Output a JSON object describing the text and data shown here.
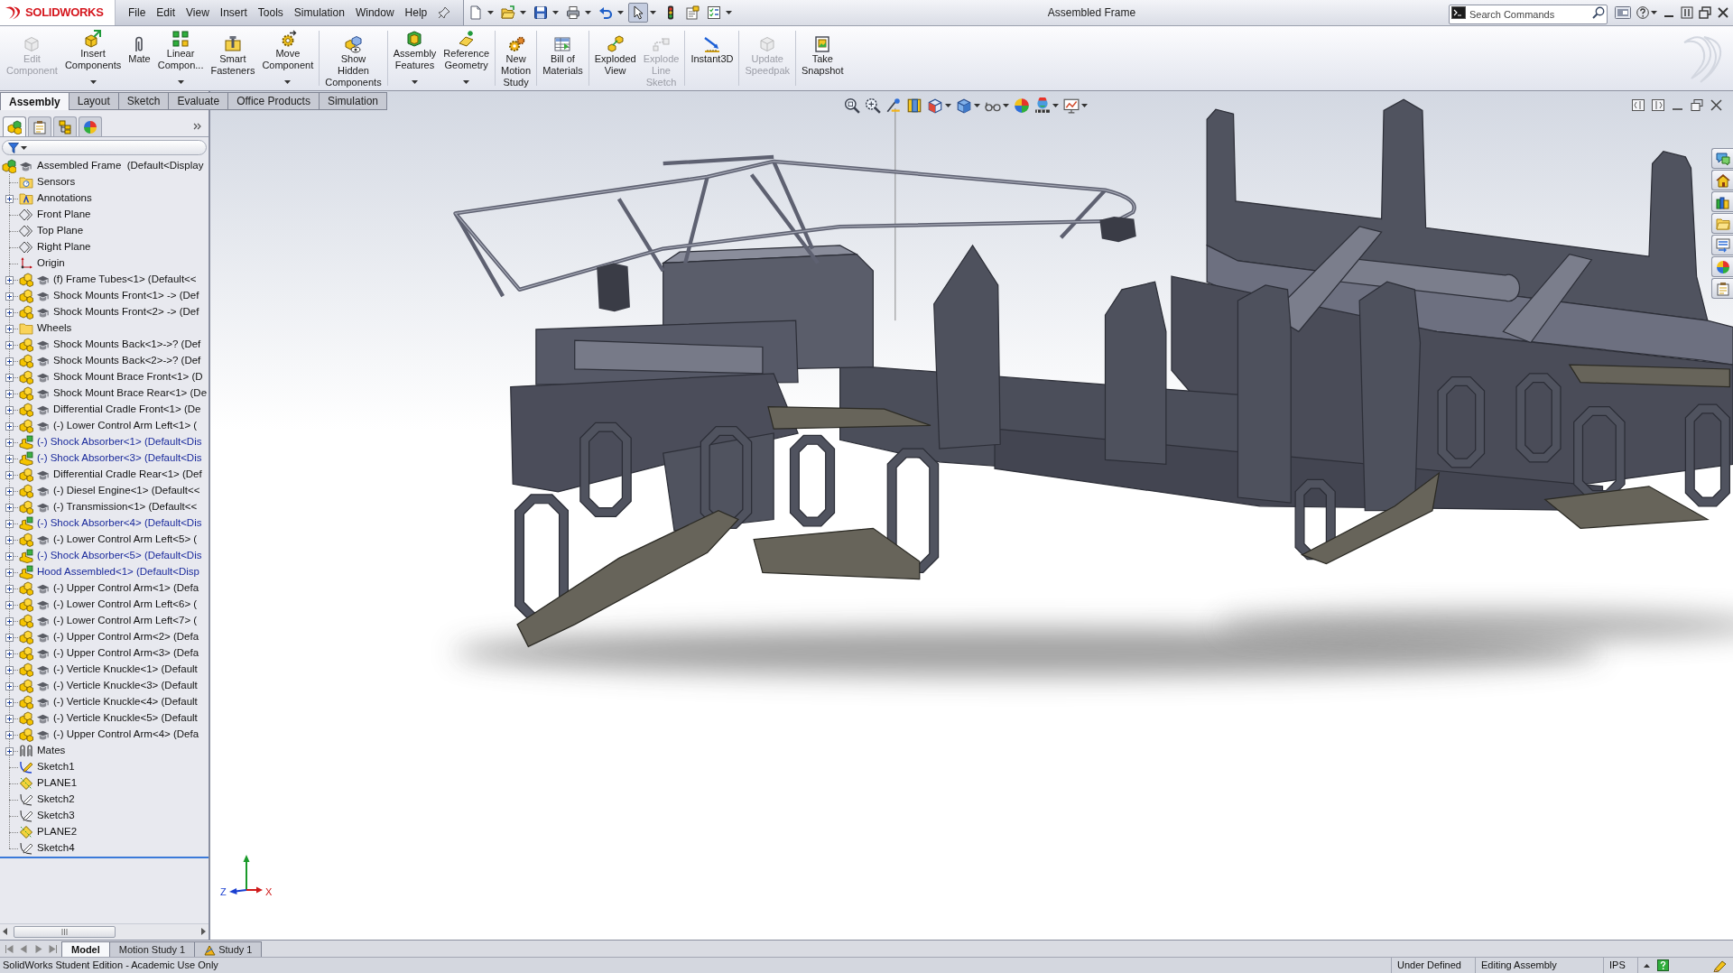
{
  "app": {
    "logo_text": "SOLIDWORKS"
  },
  "menu": [
    "File",
    "Edit",
    "View",
    "Insert",
    "Tools",
    "Simulation",
    "Window",
    "Help"
  ],
  "quick_access": [
    {
      "kind": "new",
      "dropdown": true,
      "pressed": false
    },
    {
      "kind": "open",
      "dropdown": true,
      "pressed": false
    },
    {
      "kind": "save",
      "dropdown": true,
      "pressed": false
    },
    {
      "kind": "print",
      "dropdown": true,
      "pressed": false
    },
    {
      "kind": "undo",
      "dropdown": true,
      "pressed": false
    },
    {
      "kind": "select",
      "dropdown": true,
      "pressed": true
    },
    {
      "kind": "rebuild",
      "dropdown": false,
      "pressed": false
    },
    {
      "kind": "properties",
      "dropdown": false,
      "pressed": false
    },
    {
      "kind": "options",
      "dropdown": true,
      "pressed": false
    }
  ],
  "window": {
    "title": "Assembled Frame"
  },
  "search": {
    "placeholder": "Search Commands"
  },
  "ribbon": {
    "groups": [
      {
        "buttons": [
          {
            "kind": "edit",
            "label": "Edit\nComponent",
            "disabled": true,
            "dropdown": false
          },
          {
            "kind": "insert",
            "label": "Insert\nComponents",
            "disabled": false,
            "dropdown": true
          },
          {
            "kind": "mate",
            "label": "Mate",
            "disabled": false,
            "dropdown": false
          },
          {
            "kind": "pattern",
            "label": "Linear\nCompon...",
            "disabled": false,
            "dropdown": true
          },
          {
            "kind": "fastener",
            "label": "Smart\nFasteners",
            "disabled": false,
            "dropdown": false
          },
          {
            "kind": "move",
            "label": "Move\nComponent",
            "disabled": false,
            "dropdown": true
          }
        ]
      },
      {
        "buttons": [
          {
            "kind": "show",
            "label": "Show\nHidden\nComponents",
            "disabled": false,
            "dropdown": false
          }
        ]
      },
      {
        "buttons": [
          {
            "kind": "features",
            "label": "Assembly\nFeatures",
            "disabled": false,
            "dropdown": true
          },
          {
            "kind": "geometry",
            "label": "Reference\nGeometry",
            "disabled": false,
            "dropdown": true
          }
        ]
      },
      {
        "buttons": [
          {
            "kind": "motion",
            "label": "New\nMotion\nStudy",
            "disabled": false,
            "dropdown": false
          }
        ]
      },
      {
        "buttons": [
          {
            "kind": "bom",
            "label": "Bill of\nMaterials",
            "disabled": false,
            "dropdown": false
          }
        ]
      },
      {
        "buttons": [
          {
            "kind": "explode",
            "label": "Exploded\nView",
            "disabled": false,
            "dropdown": false
          },
          {
            "kind": "explodeline",
            "label": "Explode\nLine\nSketch",
            "disabled": true,
            "dropdown": false
          }
        ]
      },
      {
        "buttons": [
          {
            "kind": "instant3d",
            "label": "Instant3D",
            "disabled": false,
            "dropdown": false
          }
        ]
      },
      {
        "buttons": [
          {
            "kind": "speedpak",
            "label": "Update\nSpeedpak",
            "disabled": true,
            "dropdown": false
          }
        ]
      },
      {
        "buttons": [
          {
            "kind": "snapshot",
            "label": "Take\nSnapshot",
            "disabled": false,
            "dropdown": false
          }
        ]
      }
    ]
  },
  "command_tabs": [
    {
      "label": "Assembly",
      "selected": true
    },
    {
      "label": "Layout",
      "selected": false
    },
    {
      "label": "Sketch",
      "selected": false
    },
    {
      "label": "Evaluate",
      "selected": false
    },
    {
      "label": "Office Products",
      "selected": false
    },
    {
      "label": "Simulation",
      "selected": false
    }
  ],
  "panel_tabs": [
    {
      "kind": "feature",
      "selected": true
    },
    {
      "kind": "property",
      "selected": false
    },
    {
      "kind": "configuration",
      "selected": false
    },
    {
      "kind": "display",
      "selected": false
    }
  ],
  "feature_tree": {
    "label": "Assembled Frame  (Default<Display",
    "kind": "assembly",
    "children": [
      {
        "label": "Sensors",
        "kind": "sensors",
        "expandable": false
      },
      {
        "label": "Annotations",
        "kind": "annotations",
        "expandable": true
      },
      {
        "label": "Front Plane",
        "kind": "plane",
        "expandable": false
      },
      {
        "label": "Top Plane",
        "kind": "plane",
        "expandable": false
      },
      {
        "label": "Right Plane",
        "kind": "plane",
        "expandable": false
      },
      {
        "label": "Origin",
        "kind": "origin",
        "expandable": false
      },
      {
        "label": "(f) Frame Tubes<1> (Default<<",
        "kind": "part",
        "expandable": true
      },
      {
        "label": "Shock Mounts Front<1> -> (Def",
        "kind": "part",
        "expandable": true
      },
      {
        "label": "Shock Mounts Front<2> -> (Def",
        "kind": "part",
        "expandable": true
      },
      {
        "label": "Wheels",
        "kind": "folder",
        "expandable": true
      },
      {
        "label": "Shock Mounts Back<1>->? (Def",
        "kind": "part",
        "expandable": true
      },
      {
        "label": "Shock Mounts Back<2>->? (Def",
        "kind": "part",
        "expandable": true
      },
      {
        "label": "Shock Mount Brace Front<1> (D",
        "kind": "part",
        "expandable": true
      },
      {
        "label": "Shock Mount Brace Rear<1> (De",
        "kind": "part",
        "expandable": true
      },
      {
        "label": "Differential Cradle Front<1> (De",
        "kind": "part",
        "expandable": true
      },
      {
        "label": "(-) Lower Control Arm Left<1> (",
        "kind": "part",
        "expandable": true
      },
      {
        "label": "(-) Shock Absorber<1> (Default<Dis",
        "kind": "subassembly",
        "expandable": true
      },
      {
        "label": "(-) Shock Absorber<3> (Default<Dis",
        "kind": "subassembly",
        "expandable": true
      },
      {
        "label": "Differential Cradle Rear<1> (Def",
        "kind": "part",
        "expandable": true
      },
      {
        "label": "(-) Diesel Engine<1> (Default<<",
        "kind": "part",
        "expandable": true
      },
      {
        "label": "(-) Transmission<1> (Default<<",
        "kind": "part",
        "expandable": true
      },
      {
        "label": "(-) Shock Absorber<4> (Default<Dis",
        "kind": "subassembly",
        "expandable": true
      },
      {
        "label": "(-) Lower Control Arm Left<5> (",
        "kind": "part",
        "expandable": true
      },
      {
        "label": "(-) Shock Absorber<5> (Default<Dis",
        "kind": "subassembly",
        "expandable": true
      },
      {
        "label": "Hood Assembled<1> (Default<Disp",
        "kind": "subassembly",
        "expandable": true
      },
      {
        "label": "(-) Upper Control Arm<1> (Defa",
        "kind": "part",
        "expandable": true
      },
      {
        "label": "(-) Lower Control Arm Left<6> (",
        "kind": "part",
        "expandable": true
      },
      {
        "label": "(-) Lower Control Arm Left<7> (",
        "kind": "part",
        "expandable": true
      },
      {
        "label": "(-) Upper Control Arm<2> (Defa",
        "kind": "part",
        "expandable": true
      },
      {
        "label": "(-) Upper Control Arm<3> (Defa",
        "kind": "part",
        "expandable": true
      },
      {
        "label": "(-) Verticle Knuckle<1> (Default",
        "kind": "part",
        "expandable": true
      },
      {
        "label": "(-) Verticle Knuckle<3> (Default",
        "kind": "part",
        "expandable": true
      },
      {
        "label": "(-) Verticle Knuckle<4> (Default",
        "kind": "part",
        "expandable": true
      },
      {
        "label": "(-) Verticle Knuckle<5> (Default",
        "kind": "part",
        "expandable": true
      },
      {
        "label": "(-) Upper Control Arm<4> (Defa",
        "kind": "part",
        "expandable": true
      },
      {
        "label": "Mates",
        "kind": "mates",
        "expandable": true
      },
      {
        "label": "Sketch1",
        "kind": "activesketch",
        "expandable": false
      },
      {
        "label": "PLANE1",
        "kind": "refplane",
        "expandable": false
      },
      {
        "label": "Sketch2",
        "kind": "sketch",
        "expandable": false
      },
      {
        "label": "Sketch3",
        "kind": "sketch",
        "expandable": false
      },
      {
        "label": "PLANE2",
        "kind": "refplane",
        "expandable": false
      },
      {
        "label": "Sketch4",
        "kind": "sketch",
        "expandable": false
      }
    ]
  },
  "view_toolbar": [
    {
      "kind": "zoomfit",
      "dropdown": false
    },
    {
      "kind": "zoomarea",
      "dropdown": false
    },
    {
      "kind": "previous",
      "dropdown": false
    },
    {
      "kind": "section",
      "dropdown": false
    },
    {
      "kind": "orientation",
      "dropdown": true
    },
    {
      "kind": "display",
      "dropdown": true
    },
    {
      "kind": "hideshow",
      "dropdown": true
    },
    {
      "kind": "appearance",
      "dropdown": false
    },
    {
      "kind": "scene",
      "dropdown": true
    },
    {
      "kind": "settings",
      "dropdown": true
    }
  ],
  "triad": {
    "z_label": "Z",
    "x_label": "X"
  },
  "bottom_tabs": [
    {
      "label": "Model",
      "kind": "model",
      "selected": true
    },
    {
      "label": "Motion Study 1",
      "kind": "motion",
      "selected": false
    },
    {
      "label": "Study 1",
      "kind": "simulation",
      "selected": false
    }
  ],
  "status_bar": {
    "text": "SolidWorks Student Edition - Academic Use Only",
    "fields": [
      "Under Defined",
      "Editing Assembly",
      "IPS"
    ]
  }
}
